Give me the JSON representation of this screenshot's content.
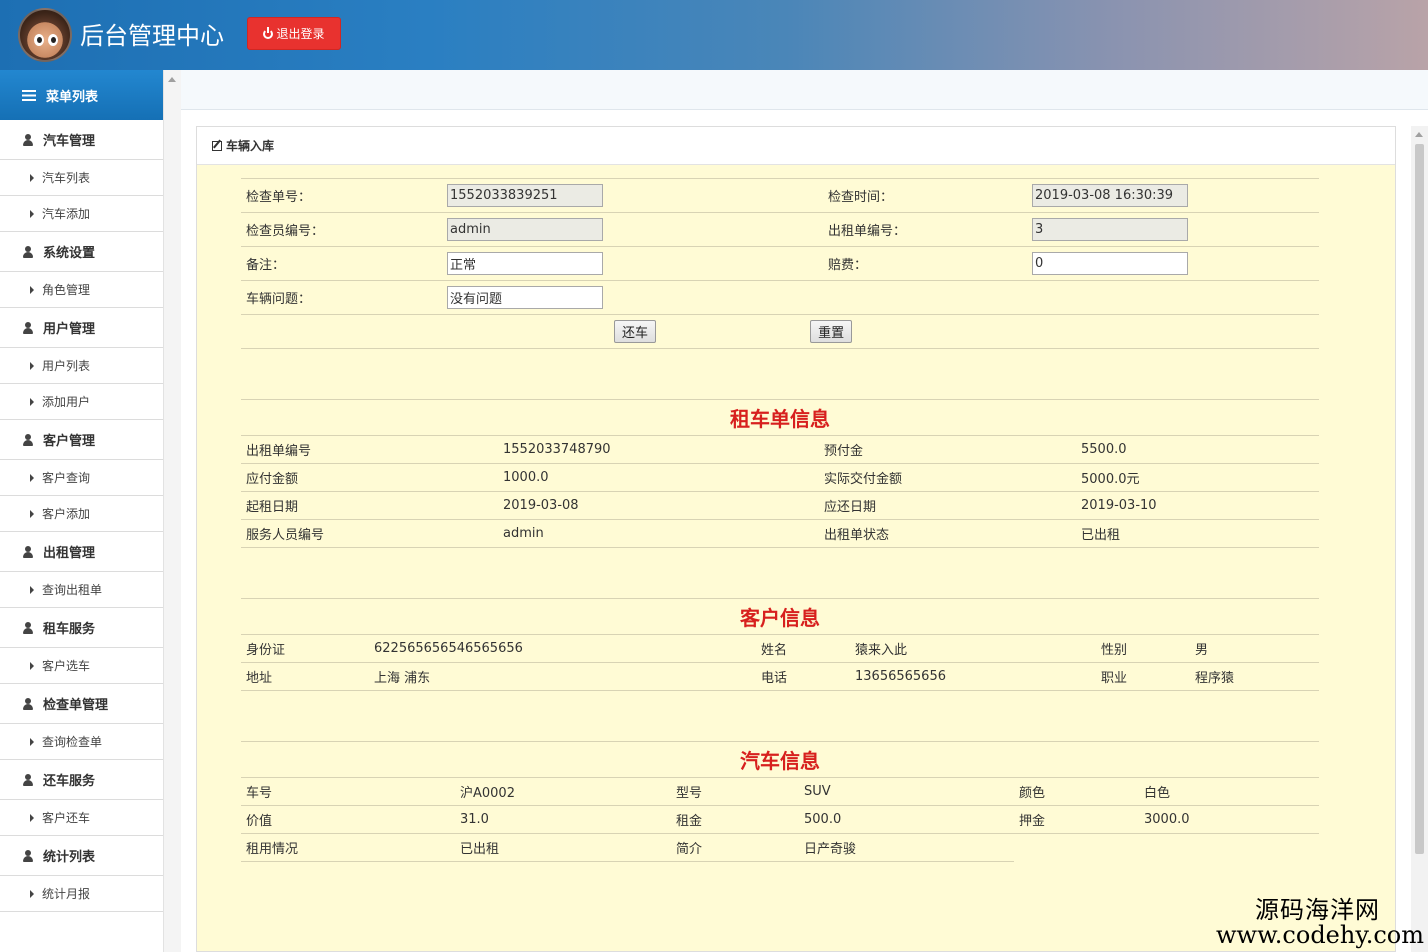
{
  "header": {
    "title": "后台管理中心",
    "logout_label": "退出登录"
  },
  "sidebar": {
    "menu_title": "菜单列表",
    "groups": [
      {
        "label": "汽车管理",
        "items": [
          "汽车列表",
          "汽车添加"
        ]
      },
      {
        "label": "系统设置",
        "items": [
          "角色管理"
        ]
      },
      {
        "label": "用户管理",
        "items": [
          "用户列表",
          "添加用户"
        ]
      },
      {
        "label": "客户管理",
        "items": [
          "客户查询",
          "客户添加"
        ]
      },
      {
        "label": "出租管理",
        "items": [
          "查询出租单"
        ]
      },
      {
        "label": "租车服务",
        "items": [
          "客户选车"
        ]
      },
      {
        "label": "检查单管理",
        "items": [
          "查询检查单"
        ]
      },
      {
        "label": "还车服务",
        "items": [
          "客户还车"
        ]
      },
      {
        "label": "统计列表",
        "items": [
          "统计月报"
        ]
      }
    ]
  },
  "panel": {
    "title": "车辆入库"
  },
  "form": {
    "check_no_label": "检查单号：",
    "check_no": "1552033839251",
    "check_time_label": "检查时间：",
    "check_time": "2019-03-08 16:30:39",
    "inspector_label": "检查员编号：",
    "inspector": "admin",
    "rent_no_label": "出租单编号：",
    "rent_no": "3",
    "remark_label": "备注：",
    "remark": "正常",
    "compensation_label": "赔费：",
    "compensation": "0",
    "problem_label": "车辆问题：",
    "problem": "没有问题",
    "return_button": "还车",
    "reset_button": "重置"
  },
  "rental": {
    "title": "租车单信息",
    "rent_no_label": "出租单编号",
    "rent_no": "1552033748790",
    "prepay_label": "预付金",
    "prepay": "5500.0",
    "payable_label": "应付金额",
    "payable": "1000.0",
    "actual_label": "实际交付金额",
    "actual": "5000.0元",
    "start_label": "起租日期",
    "start": "2019-03-08",
    "due_label": "应还日期",
    "due": "2019-03-10",
    "staff_label": "服务人员编号",
    "staff": "admin",
    "status_label": "出租单状态",
    "status": "已出租"
  },
  "customer": {
    "title": "客户信息",
    "id_label": "身份证",
    "id": "622565656546565656",
    "name_label": "姓名",
    "name": "猿来入此",
    "gender_label": "性别",
    "gender": "男",
    "address_label": "地址",
    "address": "上海 浦东",
    "phone_label": "电话",
    "phone": "13656565656",
    "job_label": "职业",
    "job": "程序猿"
  },
  "car": {
    "title": "汽车信息",
    "plate_label": "车号",
    "plate": "沪A0002",
    "model_label": "型号",
    "model": "SUV",
    "color_label": "颜色",
    "color": "白色",
    "value_label": "价值",
    "value": "31.0",
    "rent_label": "租金",
    "rent": "500.0",
    "deposit_label": "押金",
    "deposit": "3000.0",
    "usage_label": "租用情况",
    "usage": "已出租",
    "intro_label": "简介",
    "intro": "日产奇骏"
  },
  "watermark": {
    "cn": "源码海洋网",
    "en": "www.codehy.com"
  }
}
